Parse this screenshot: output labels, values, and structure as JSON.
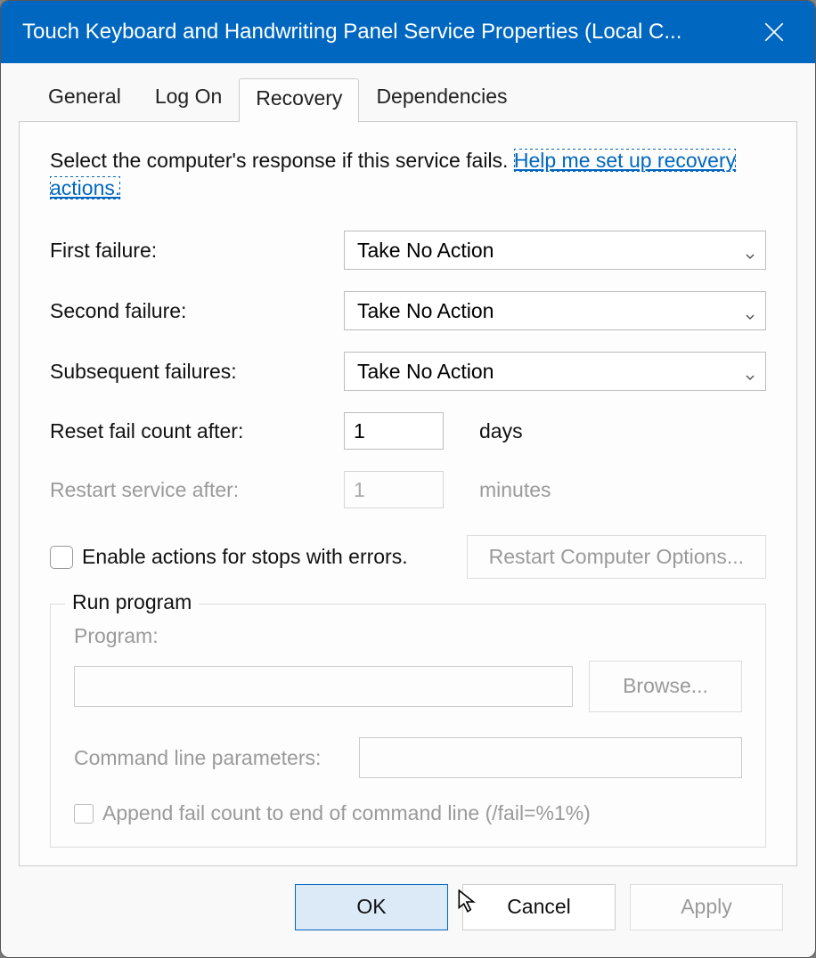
{
  "window": {
    "title": "Touch Keyboard and Handwriting Panel Service Properties (Local C..."
  },
  "tabs": [
    "General",
    "Log On",
    "Recovery",
    "Dependencies"
  ],
  "activeTab": 2,
  "intro": {
    "text": "Select the computer's response if this service fails. ",
    "link": "Help me set up recovery actions."
  },
  "failures": {
    "first_label": "First failure:",
    "first_value": "Take No Action",
    "second_label": "Second failure:",
    "second_value": "Take No Action",
    "subsequent_label": "Subsequent failures:",
    "subsequent_value": "Take No Action"
  },
  "reset": {
    "label": "Reset fail count after:",
    "value": "1",
    "unit": "days"
  },
  "restart": {
    "label": "Restart service after:",
    "value": "1",
    "unit": "minutes"
  },
  "enableActions": {
    "label": "Enable actions for stops with errors."
  },
  "restartOptionsBtn": "Restart Computer Options...",
  "runProgram": {
    "group": "Run program",
    "program_label": "Program:",
    "program_value": "",
    "browse": "Browse...",
    "cmd_label": "Command line parameters:",
    "cmd_value": "",
    "append_label": "Append fail count to end of command line (/fail=%1%)"
  },
  "buttons": {
    "ok": "OK",
    "cancel": "Cancel",
    "apply": "Apply"
  }
}
